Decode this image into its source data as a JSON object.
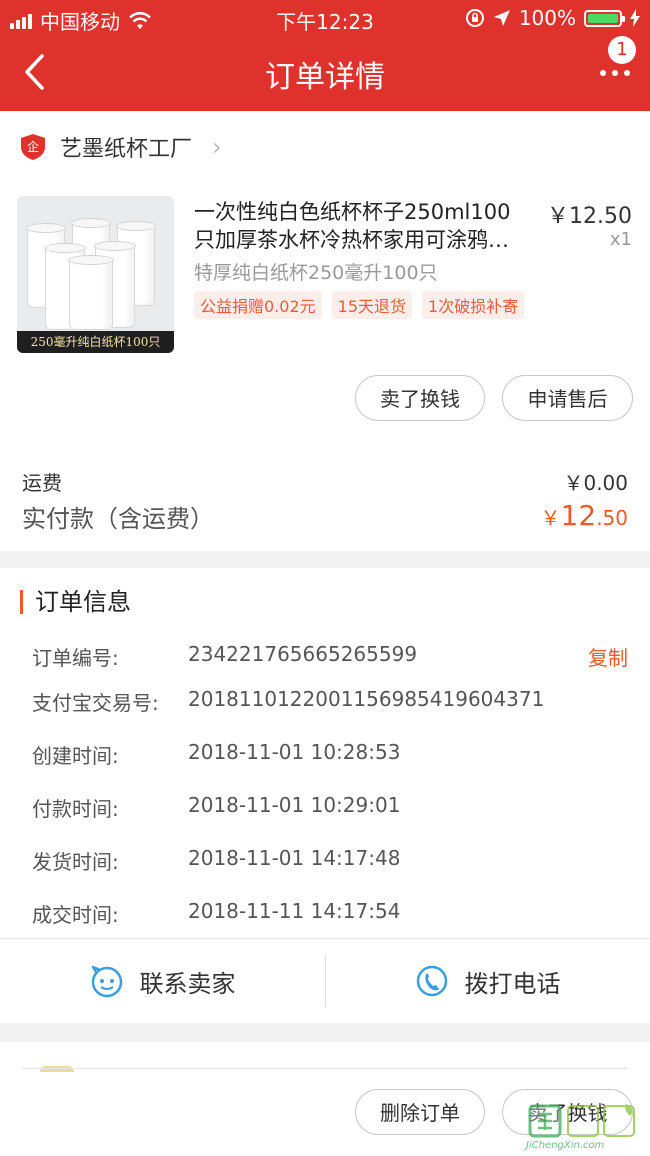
{
  "status_bar": {
    "carrier": "中国移动",
    "time": "下午12:23",
    "battery": "100%"
  },
  "nav": {
    "title": "订单详情",
    "badge_count": "1"
  },
  "shop": {
    "name": "艺墨纸杯工厂"
  },
  "product": {
    "title_line1": "一次性纯白色纸杯杯子250ml100",
    "title_line2": "只加厚茶水杯冷热杯家用可涂鸦…",
    "price": "￥12.50",
    "quantity": "x1",
    "spec": "特厚纯白纸杯250毫升100只",
    "image_caption": "250毫升纯白纸杯100只",
    "tags": [
      "公益捐赠0.02元",
      "15天退货",
      "1次破损补寄"
    ]
  },
  "actions": {
    "sell_exchange": "卖了换钱",
    "after_sale": "申请售后"
  },
  "totals": {
    "shipping_label": "运费",
    "shipping_value": "￥0.00",
    "paid_label": "实付款（含运费）",
    "paid_currency": "￥",
    "paid_int": "12",
    "paid_dec": ".50"
  },
  "order_info": {
    "title": "订单信息",
    "copy_label": "复制",
    "rows": [
      {
        "label": "订单编号:",
        "value": "234221765665265599"
      },
      {
        "label": "支付宝交易号:",
        "value": "2018110122001156985419604371"
      },
      {
        "label": "创建时间:",
        "value": "2018-11-01 10:28:53"
      },
      {
        "label": "付款时间:",
        "value": "2018-11-01 10:29:01"
      },
      {
        "label": "发货时间:",
        "value": "2018-11-01 14:17:48"
      },
      {
        "label": "成交时间:",
        "value": "2018-11-11 14:17:54"
      }
    ]
  },
  "contact": {
    "seller": "联系卖家",
    "phone": "拨打电话"
  },
  "bottom_actions": {
    "delete_order": "删除订单",
    "sell_exchange": "卖了换钱"
  },
  "watermark": {
    "site": "JiChengXin.com"
  },
  "colors": {
    "brand_red": "#e0322c",
    "accent_orange": "#f05a24",
    "icon_blue": "#3a9de0"
  }
}
